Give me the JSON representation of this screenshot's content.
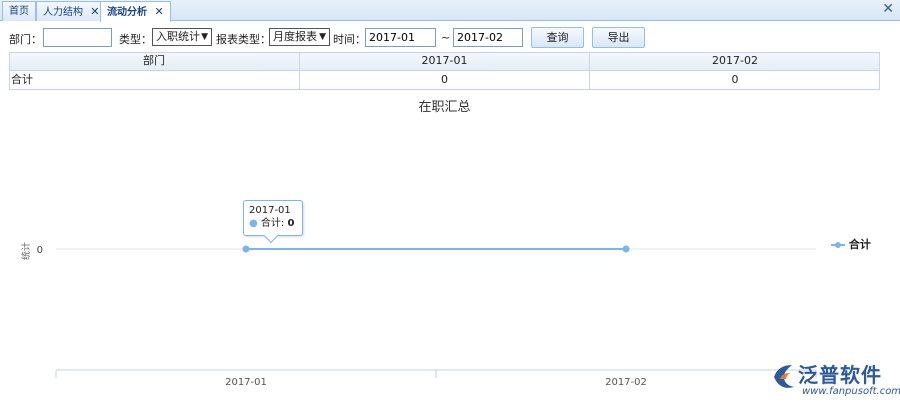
{
  "tabs": [
    {
      "label": "首页",
      "closable": false,
      "active": false
    },
    {
      "label": "人力结构",
      "closable": true,
      "active": false
    },
    {
      "label": "流动分析",
      "closable": true,
      "active": true
    }
  ],
  "close_all": "✕",
  "tab_close_glyph": "✕",
  "filters": {
    "dept_label": "部门：",
    "dept_value": "",
    "type_label": "类型：",
    "type_value": "入职统计",
    "report_label": "报表类型：",
    "report_value": "月度报表",
    "time_label": "时间：",
    "time_from": "2017-01",
    "time_sep": "~",
    "time_to": "2017-02",
    "query_button": "查询",
    "export_button": "导出"
  },
  "table": {
    "headers": [
      "部门",
      "2017-01",
      "2017-02"
    ],
    "rows": [
      [
        "合计",
        "0",
        "0"
      ]
    ]
  },
  "chart_data": {
    "type": "line",
    "title": "在职汇总",
    "ylabel": "统计",
    "categories": [
      "2017-01",
      "2017-02"
    ],
    "series": [
      {
        "name": "合计",
        "values": [
          0,
          0
        ]
      }
    ],
    "yticks": [
      "0"
    ],
    "legend": "right",
    "tooltip": {
      "category": "2017-01",
      "series": "合计",
      "value": "0"
    }
  },
  "colors": {
    "series": "#7cb5ec",
    "accent": "#99bce8"
  },
  "logo": {
    "brand": "泛普软件",
    "url": "www.fanpusoft.com"
  }
}
